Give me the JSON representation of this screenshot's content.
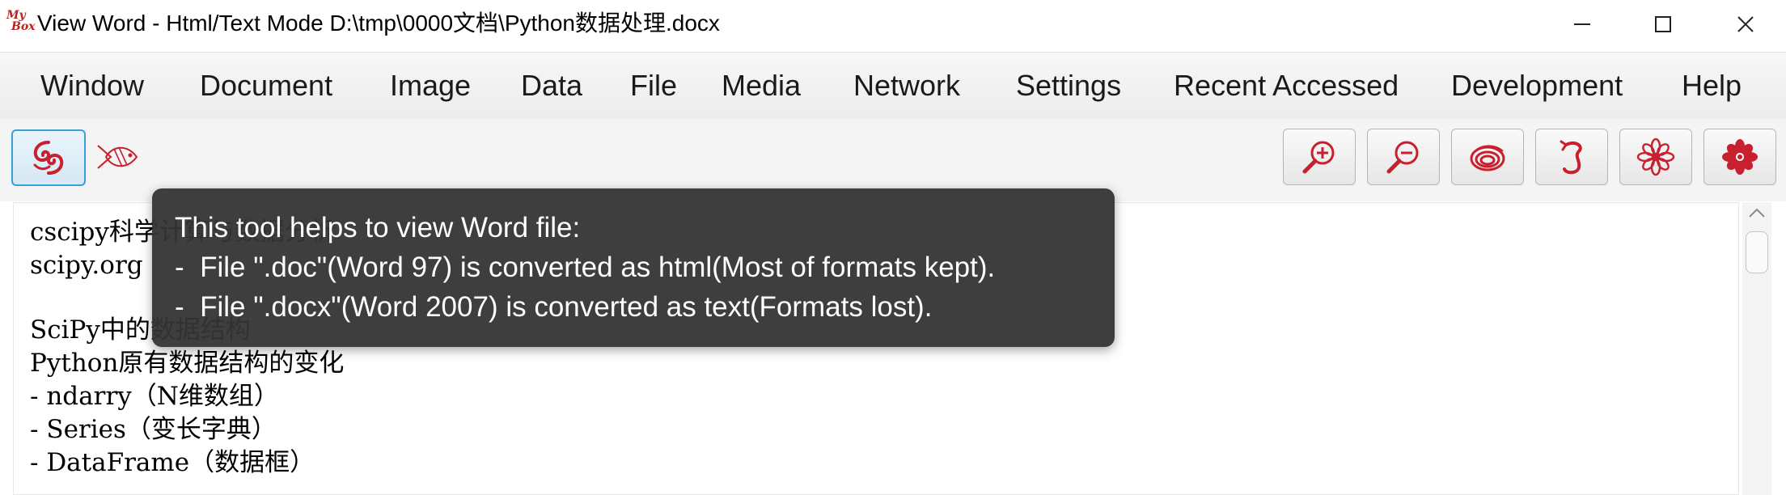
{
  "window": {
    "logo_text": [
      "My",
      "Box"
    ],
    "title": "View Word - Html/Text Mode D:\\tmp\\0000文档\\Python数据处理.docx",
    "controls": [
      "minimize-icon",
      "maximize-icon",
      "close-icon"
    ]
  },
  "menu": {
    "items": [
      "Window",
      "Document",
      "Image",
      "Data",
      "File",
      "Media",
      "Network",
      "Settings",
      "Recent Accessed",
      "Development",
      "Help"
    ]
  },
  "toolbar": {
    "left_icons": [
      "swirl-logo-icon",
      "fish-icon"
    ],
    "right_icons": [
      "zoom-in-icon",
      "zoom-out-icon",
      "spiral-icon",
      "dragon-icon",
      "flower-outline-icon",
      "flower-solid-icon"
    ],
    "accent_color": "#c8202e"
  },
  "document": {
    "lines": [
      "cscipy科学计算与数据分析",
      "scipy.org",
      "",
      "SciPy中的数据结构",
      "Python原有数据结构的变化",
      "- ndarry（N维数组）",
      "- Series（变长字典）",
      "- DataFrame（数据框）"
    ]
  },
  "tooltip": {
    "lines": [
      "This tool helps to view Word file:",
      "-  File \".doc\"(Word 97) is converted as html(Most of formats kept).",
      "-  File \".docx\"(Word 2007) is converted as text(Formats lost)."
    ]
  }
}
